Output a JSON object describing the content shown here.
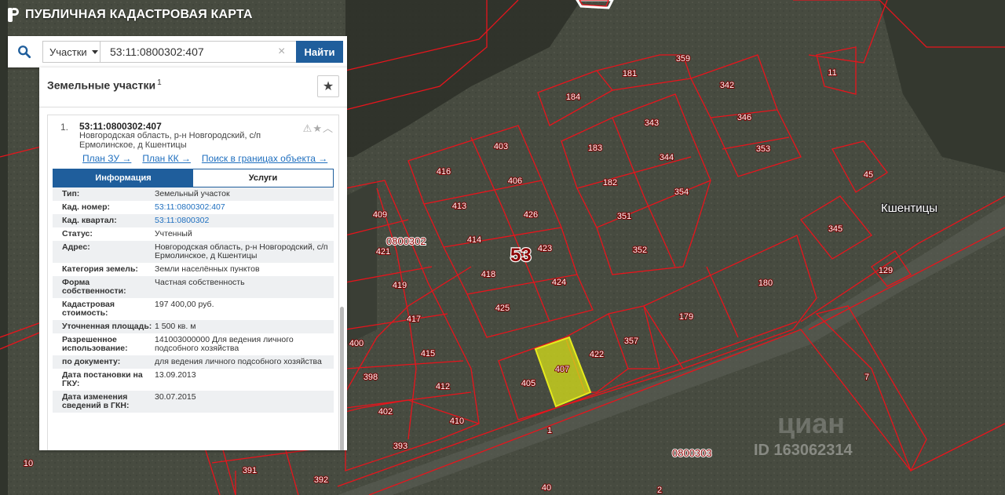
{
  "app": {
    "title": "ПУБЛИЧНАЯ КАДАСТРОВАЯ КАРТА"
  },
  "search": {
    "type_label": "Участки",
    "query": "53:11:0800302:407",
    "find_label": "Найти"
  },
  "panel": {
    "title": "Земельные участки",
    "count": "1",
    "item": {
      "index": "1.",
      "cad_number": "53:11:0800302:407",
      "address": "Новгородская область, р-н Новгородский, с/п Ермолинское, д Кшентицы",
      "links": [
        "План ЗУ →",
        "План КК →",
        "Поиск в границах объекта →"
      ],
      "tabs": [
        "Информация",
        "Услуги"
      ],
      "fields": [
        {
          "key": "Тип:",
          "value": "Земельный участок"
        },
        {
          "key": "Кад. номер:",
          "value": "53:11:0800302:407"
        },
        {
          "key": "Кад. квартал:",
          "value": "53:11:0800302"
        },
        {
          "key": "Статус:",
          "value": "Учтенный"
        },
        {
          "key": "Адрес:",
          "value": "Новгородская область, р-н Новгородский, с/п Ермолинское, д Кшентицы"
        },
        {
          "key": "Категория земель:",
          "value": "Земли населённых пунктов"
        },
        {
          "key": "Форма собственности:",
          "value": "Частная собственность"
        },
        {
          "key": "Кадастровая стоимость:",
          "value": "197 400,00 руб."
        },
        {
          "key": "Уточненная площадь:",
          "value": "1 500 кв. м"
        },
        {
          "key": "Разрешенное использование:",
          "value": "141003000000 Для ведения личного подсобного хозяйства"
        },
        {
          "key": "по документу:",
          "value": "для ведения личного подсобного хозяйства"
        },
        {
          "key": "Дата постановки на ГКУ:",
          "value": "13.09.2013"
        },
        {
          "key": "Дата изменения сведений в ГКН:",
          "value": "30.07.2015"
        }
      ]
    }
  },
  "map": {
    "colors": {
      "boundary": "#e8141c",
      "highlight": "#e6ea1e",
      "label_bg": "#ffffff"
    },
    "village": "Кшентицы",
    "quarters": [
      "0800302",
      "0800303"
    ],
    "district": "53",
    "parcels": [
      "359",
      "181",
      "184",
      "343",
      "342",
      "346",
      "353",
      "183",
      "344",
      "182",
      "354",
      "351",
      "352",
      "403",
      "416",
      "406",
      "413",
      "426",
      "414",
      "423",
      "418",
      "424",
      "425",
      "409",
      "421",
      "419",
      "417",
      "400",
      "415",
      "398",
      "412",
      "402",
      "410",
      "393",
      "391",
      "392",
      "405",
      "407",
      "422",
      "357",
      "179",
      "180",
      "45",
      "345",
      "129",
      "11",
      "7",
      "1",
      "10",
      "40",
      "2",
      "391"
    ],
    "watermark": "ID 163062314"
  }
}
